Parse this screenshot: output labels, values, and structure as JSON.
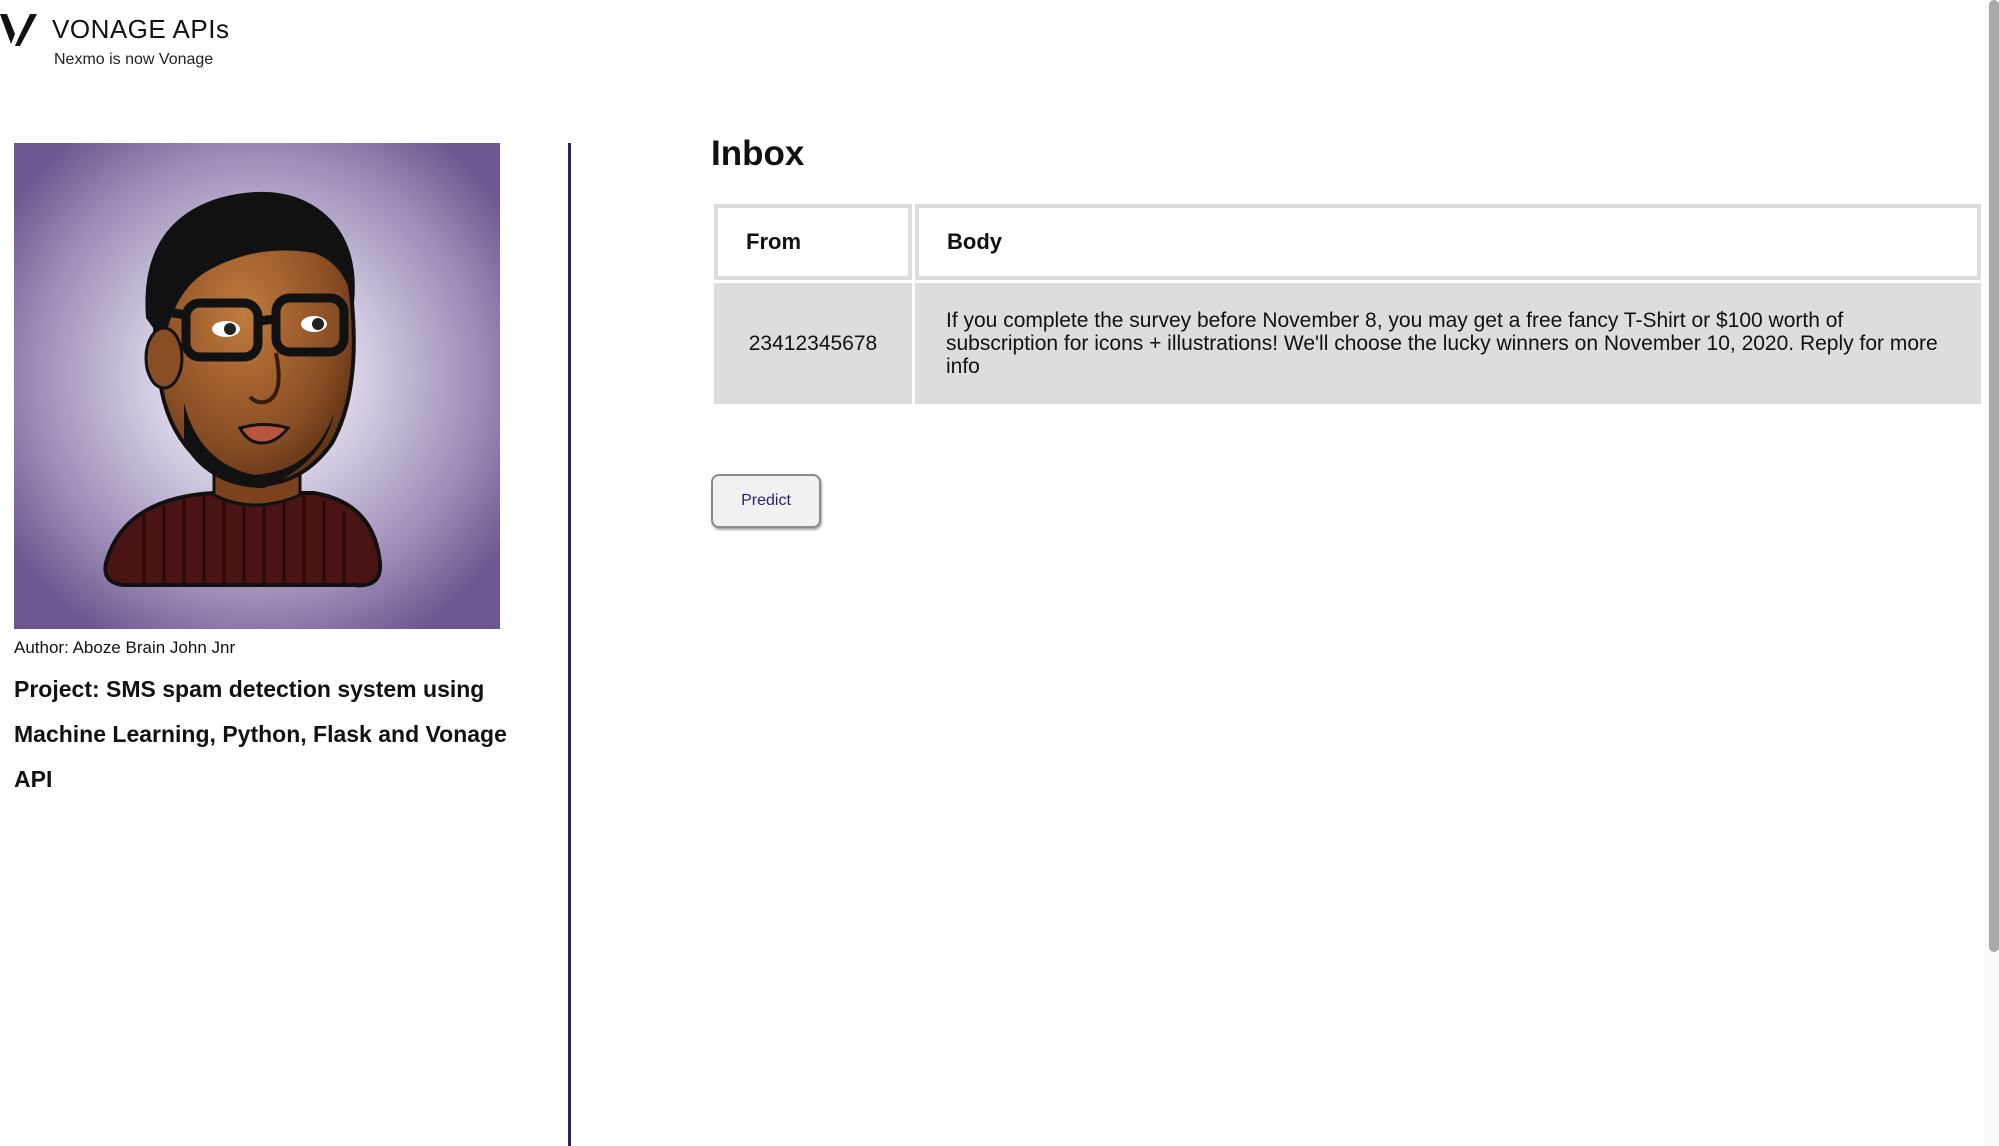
{
  "header": {
    "brand": "VONAGE APIs",
    "tagline": "Nexmo is now Vonage",
    "logo_icon": "vonage-v-logo"
  },
  "sidebar": {
    "avatar_icon": "author-avatar-illustration",
    "author": "Author: Aboze Brain John Jnr",
    "project": "Project: SMS spam detection system using Machine Learning, Python, Flask and Vonage API"
  },
  "main": {
    "title": "Inbox",
    "table": {
      "headers": [
        "From",
        "Body"
      ],
      "rows": [
        {
          "from": "23412345678",
          "body": "If you complete the survey before November 8, you may get a free fancy T-Shirt or $100 worth of subscription for icons + illustrations! We'll choose the lucky winners on November 10, 2020. Reply for more info"
        }
      ]
    },
    "predict_label": "Predict"
  },
  "colors": {
    "divider": "#2b1f6e",
    "row_bg": "#dddddd",
    "header_border": "#dcdcdc",
    "button_text": "#2b1f6e"
  }
}
